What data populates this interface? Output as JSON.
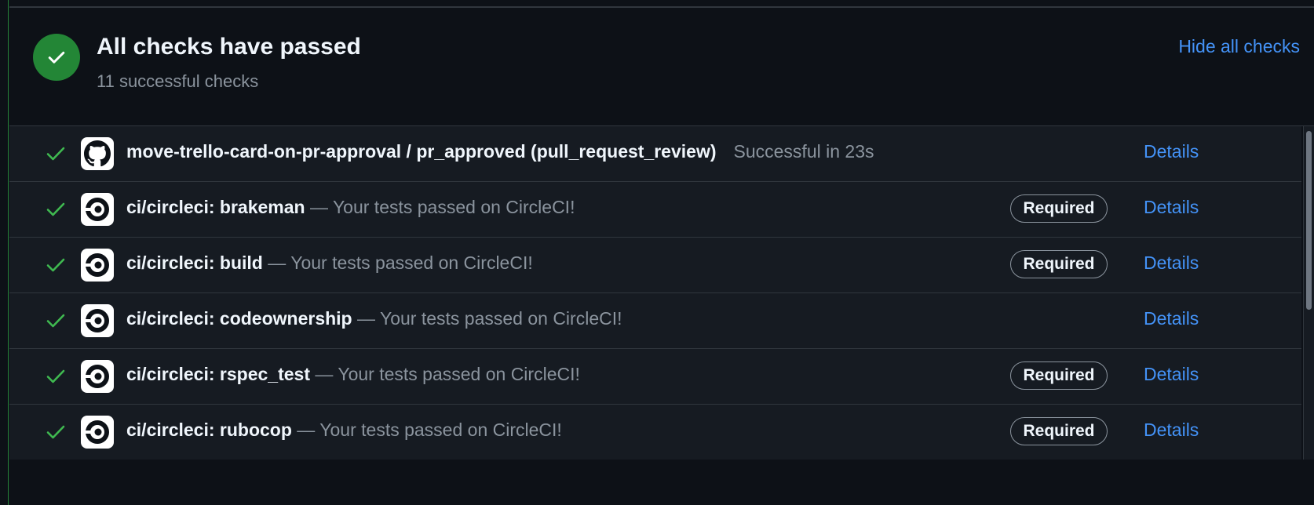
{
  "summary": {
    "title": "All checks have passed",
    "subtitle": "11 successful checks",
    "hide_link": "Hide all checks"
  },
  "checks": [
    {
      "app_icon": "github-icon",
      "name": "move-trello-card-on-pr-approval / pr_approved (pull_request_review)",
      "status": "Successful in 23s",
      "required": "",
      "details": "Details"
    },
    {
      "app_icon": "circleci-icon",
      "name": "ci/circleci: brakeman",
      "desc": " — Your tests passed on CircleCI!",
      "required": "Required",
      "details": "Details"
    },
    {
      "app_icon": "circleci-icon",
      "name": "ci/circleci: build",
      "desc": " — Your tests passed on CircleCI!",
      "required": "Required",
      "details": "Details"
    },
    {
      "app_icon": "circleci-icon",
      "name": "ci/circleci: codeownership",
      "desc": " — Your tests passed on CircleCI!",
      "required": "",
      "details": "Details"
    },
    {
      "app_icon": "circleci-icon",
      "name": "ci/circleci: rspec_test",
      "desc": " — Your tests passed on CircleCI!",
      "required": "Required",
      "details": "Details"
    },
    {
      "app_icon": "circleci-icon",
      "name": "ci/circleci: rubocop",
      "desc": " — Your tests passed on CircleCI!",
      "required": "Required",
      "details": "Details"
    }
  ],
  "colors": {
    "success": "#3fb950",
    "link": "#4493f8",
    "badge_success": "#238636"
  }
}
